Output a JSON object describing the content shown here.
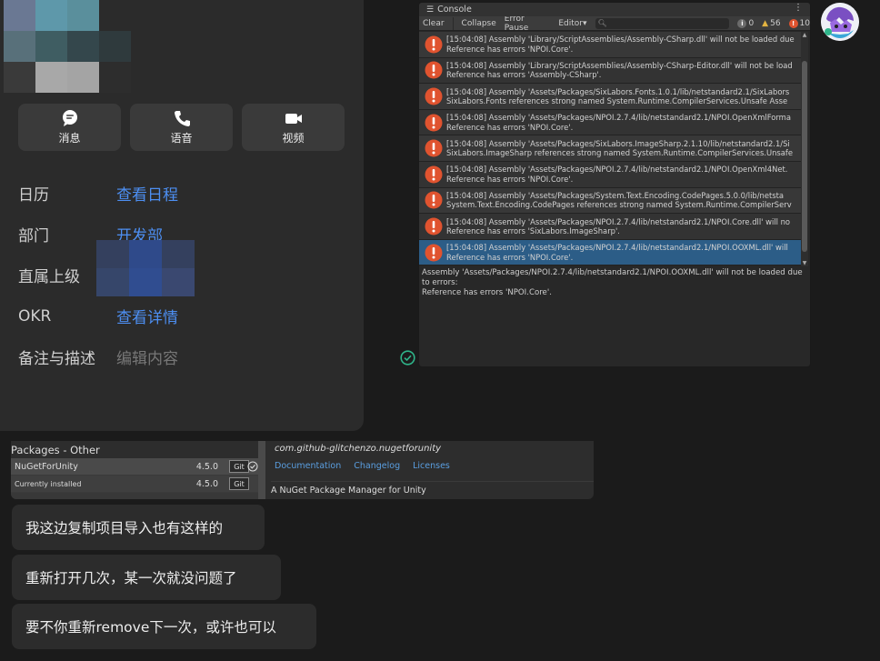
{
  "profile": {
    "actions": [
      {
        "label": "消息"
      },
      {
        "label": "语音"
      },
      {
        "label": "视频"
      }
    ],
    "info": [
      {
        "key": "日历",
        "value": "查看日程"
      },
      {
        "key": "部门",
        "value": "开发部"
      },
      {
        "key": "直属上级",
        "value": ""
      },
      {
        "key": "OKR",
        "value": "查看详情"
      },
      {
        "key": "备注与描述",
        "value": "编辑内容"
      }
    ]
  },
  "console": {
    "tab_label": "Console",
    "toolbar": {
      "clear": "Clear",
      "collapse": "Collapse",
      "error_pause": "Error Pause",
      "editor": "Editor",
      "search_placeholder": "",
      "info_count": "0",
      "warning_count": "56",
      "error_count": "10"
    },
    "logs": [
      {
        "line1": "[15:04:08] Assembly 'Library/ScriptAssemblies/Assembly-CSharp.dll' will not be loaded due",
        "line2": "Reference has errors 'NPOI.Core'."
      },
      {
        "line1": "[15:04:08] Assembly 'Library/ScriptAssemblies/Assembly-CSharp-Editor.dll' will not be load",
        "line2": "Reference has errors 'Assembly-CSharp'."
      },
      {
        "line1": "[15:04:08] Assembly 'Assets/Packages/SixLabors.Fonts.1.0.1/lib/netstandard2.1/SixLabors",
        "line2": "SixLabors.Fonts references strong named System.Runtime.CompilerServices.Unsafe Asse"
      },
      {
        "line1": "[15:04:08] Assembly 'Assets/Packages/NPOI.2.7.4/lib/netstandard2.1/NPOI.OpenXmlForma",
        "line2": "Reference has errors 'NPOI.Core'."
      },
      {
        "line1": "[15:04:08] Assembly 'Assets/Packages/SixLabors.ImageSharp.2.1.10/lib/netstandard2.1/Si",
        "line2": "SixLabors.ImageSharp references strong named System.Runtime.CompilerServices.Unsafe"
      },
      {
        "line1": "[15:04:08] Assembly 'Assets/Packages/NPOI.2.7.4/lib/netstandard2.1/NPOI.OpenXml4Net.",
        "line2": "Reference has errors 'NPOI.Core'."
      },
      {
        "line1": "[15:04:08] Assembly 'Assets/Packages/System.Text.Encoding.CodePages.5.0.0/lib/netsta",
        "line2": "System.Text.Encoding.CodePages references strong named System.Runtime.CompilerServ"
      },
      {
        "line1": "[15:04:08] Assembly 'Assets/Packages/NPOI.2.7.4/lib/netstandard2.1/NPOI.Core.dll' will no",
        "line2": "Reference has errors 'SixLabors.ImageSharp'."
      },
      {
        "line1": "[15:04:08] Assembly 'Assets/Packages/NPOI.2.7.4/lib/netstandard2.1/NPOI.OOXML.dll' will",
        "line2": "Reference has errors 'NPOI.Core'."
      }
    ],
    "detail": {
      "line1": "Assembly 'Assets/Packages/NPOI.2.7.4/lib/netstandard2.1/NPOI.OOXML.dll' will not be loaded due",
      "line2": "to errors:",
      "line3": "Reference has errors 'NPOI.Core'."
    }
  },
  "packages": {
    "header": "Packages - Other",
    "item_name": "NuGetForUnity",
    "item_version": "4.5.0",
    "git_label": "Git",
    "installed_label": "Currently installed",
    "installed_version": "4.5.0",
    "package_id": "com.github-glitchenzo.nugetforunity",
    "links": [
      "Documentation",
      "Changelog",
      "Licenses"
    ],
    "description": "A NuGet Package Manager for Unity"
  },
  "chat": [
    {
      "text": "我这边复制项目导入也有这样的"
    },
    {
      "text": "重新打开几次，某一次就没问题了"
    },
    {
      "text": "要不你重新remove下一次，或许也可以"
    }
  ],
  "colors": {
    "link_blue": "#4d8ff2",
    "error_red": "#e0532f",
    "selected_row": "#2c5d87",
    "check_green": "#2fb58a"
  }
}
